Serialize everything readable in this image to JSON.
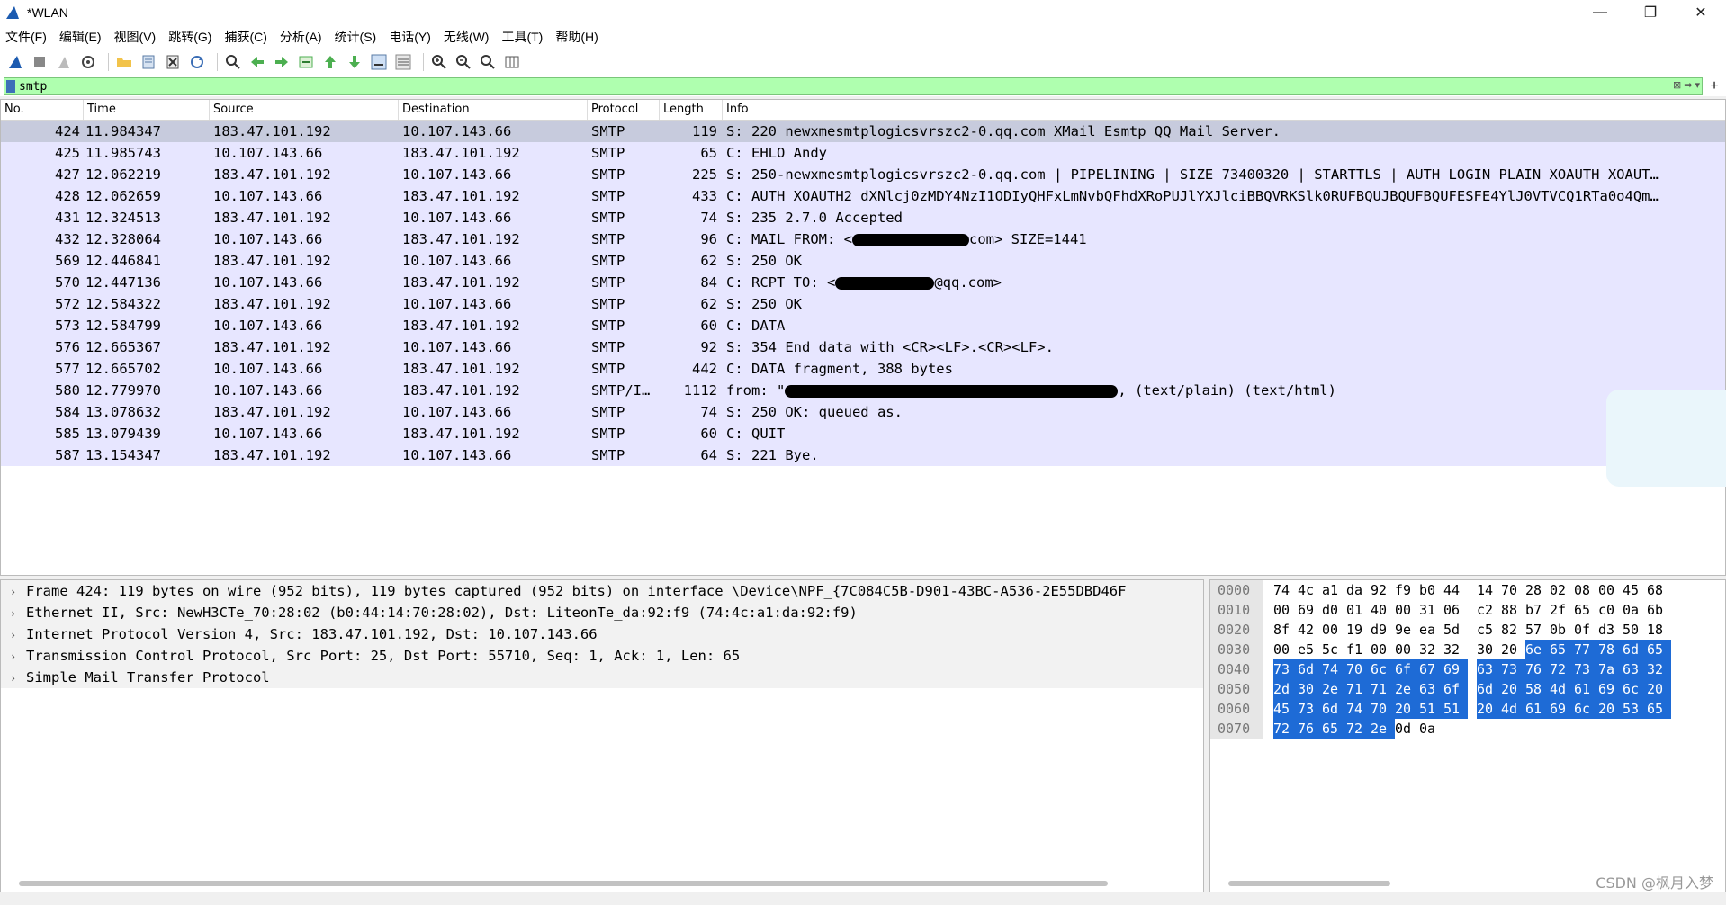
{
  "window": {
    "title": "*WLAN",
    "min": "—",
    "max": "❐",
    "close": "✕"
  },
  "menu": [
    "文件(F)",
    "编辑(E)",
    "视图(V)",
    "跳转(G)",
    "捕获(C)",
    "分析(A)",
    "统计(S)",
    "电话(Y)",
    "无线(W)",
    "工具(T)",
    "帮助(H)"
  ],
  "filter": {
    "value": "smtp",
    "plus": "+"
  },
  "columns": {
    "no": "No.",
    "time": "Time",
    "source": "Source",
    "destination": "Destination",
    "protocol": "Protocol",
    "length": "Length",
    "info": "Info"
  },
  "packets": [
    {
      "no": "424",
      "time": "11.984347",
      "src": "183.47.101.192",
      "dst": "10.107.143.66",
      "proto": "SMTP",
      "len": "119",
      "info": "S: 220 newxmesmtplogicsvrszc2-0.qq.com XMail Esmtp QQ Mail Server."
    },
    {
      "no": "425",
      "time": "11.985743",
      "src": "10.107.143.66",
      "dst": "183.47.101.192",
      "proto": "SMTP",
      "len": "65",
      "info": "C: EHLO Andy"
    },
    {
      "no": "427",
      "time": "12.062219",
      "src": "183.47.101.192",
      "dst": "10.107.143.66",
      "proto": "SMTP",
      "len": "225",
      "info": "S: 250-newxmesmtplogicsvrszc2-0.qq.com | PIPELINING | SIZE 73400320 | STARTTLS | AUTH LOGIN PLAIN XOAUTH XOAUT…"
    },
    {
      "no": "428",
      "time": "12.062659",
      "src": "10.107.143.66",
      "dst": "183.47.101.192",
      "proto": "SMTP",
      "len": "433",
      "info": "C: AUTH XOAUTH2 dXNlcj0zMDY4NzI1ODIyQHFxLmNvbQFhdXRoPUJlYXJlciBBQVRKSlk0RUFBQUJBQUFBQUFESFE4YlJ0VTVCQ1RTa0o4Qm…"
    },
    {
      "no": "431",
      "time": "12.324513",
      "src": "183.47.101.192",
      "dst": "10.107.143.66",
      "proto": "SMTP",
      "len": "74",
      "info": "S: 235 2.7.0 Accepted"
    },
    {
      "no": "432",
      "time": "12.328064",
      "src": "10.107.143.66",
      "dst": "183.47.101.192",
      "proto": "SMTP",
      "len": "96",
      "info_pre": "C: MAIL FROM: <",
      "info_post": "com> SIZE=1441",
      "redact": 130
    },
    {
      "no": "569",
      "time": "12.446841",
      "src": "183.47.101.192",
      "dst": "10.107.143.66",
      "proto": "SMTP",
      "len": "62",
      "info": "S: 250 OK"
    },
    {
      "no": "570",
      "time": "12.447136",
      "src": "10.107.143.66",
      "dst": "183.47.101.192",
      "proto": "SMTP",
      "len": "84",
      "info_pre": "C: RCPT TO: <",
      "info_post": "@qq.com>",
      "redact": 110
    },
    {
      "no": "572",
      "time": "12.584322",
      "src": "183.47.101.192",
      "dst": "10.107.143.66",
      "proto": "SMTP",
      "len": "62",
      "info": "S: 250 OK"
    },
    {
      "no": "573",
      "time": "12.584799",
      "src": "10.107.143.66",
      "dst": "183.47.101.192",
      "proto": "SMTP",
      "len": "60",
      "info": "C: DATA"
    },
    {
      "no": "576",
      "time": "12.665367",
      "src": "183.47.101.192",
      "dst": "10.107.143.66",
      "proto": "SMTP",
      "len": "92",
      "info": "S: 354 End data with <CR><LF>.<CR><LF>."
    },
    {
      "no": "577",
      "time": "12.665702",
      "src": "10.107.143.66",
      "dst": "183.47.101.192",
      "proto": "SMTP",
      "len": "442",
      "info": "C: DATA fragment, 388 bytes"
    },
    {
      "no": "580",
      "time": "12.779970",
      "src": "10.107.143.66",
      "dst": "183.47.101.192",
      "proto": "SMTP/I…",
      "len": "1112",
      "info_pre": "from: \"",
      "info_post": ",  (text/plain) (text/html)",
      "redact": 370
    },
    {
      "no": "584",
      "time": "13.078632",
      "src": "183.47.101.192",
      "dst": "10.107.143.66",
      "proto": "SMTP",
      "len": "74",
      "info": "S: 250 OK: queued as."
    },
    {
      "no": "585",
      "time": "13.079439",
      "src": "10.107.143.66",
      "dst": "183.47.101.192",
      "proto": "SMTP",
      "len": "60",
      "info": "C: QUIT"
    },
    {
      "no": "587",
      "time": "13.154347",
      "src": "183.47.101.192",
      "dst": "10.107.143.66",
      "proto": "SMTP",
      "len": "64",
      "info": "S: 221 Bye."
    }
  ],
  "details": [
    "Frame 424: 119 bytes on wire (952 bits), 119 bytes captured (952 bits) on interface \\Device\\NPF_{7C084C5B-D901-43BC-A536-2E55DBD46F",
    "Ethernet II, Src: NewH3CTe_70:28:02 (b0:44:14:70:28:02), Dst: LiteonTe_da:92:f9 (74:4c:a1:da:92:f9)",
    "Internet Protocol Version 4, Src: 183.47.101.192, Dst: 10.107.143.66",
    "Transmission Control Protocol, Src Port: 25, Dst Port: 55710, Seq: 1, Ack: 1, Len: 65",
    "Simple Mail Transfer Protocol"
  ],
  "hexdump": [
    {
      "off": "0000",
      "bytes": [
        "74",
        "4c",
        "a1",
        "da",
        "92",
        "f9",
        "b0",
        "44",
        "14",
        "70",
        "28",
        "02",
        "08",
        "00",
        "45",
        "68"
      ],
      "hl_from": 99
    },
    {
      "off": "0010",
      "bytes": [
        "00",
        "69",
        "d0",
        "01",
        "40",
        "00",
        "31",
        "06",
        "c2",
        "88",
        "b7",
        "2f",
        "65",
        "c0",
        "0a",
        "6b"
      ],
      "hl_from": 99
    },
    {
      "off": "0020",
      "bytes": [
        "8f",
        "42",
        "00",
        "19",
        "d9",
        "9e",
        "ea",
        "5d",
        "c5",
        "82",
        "57",
        "0b",
        "0f",
        "d3",
        "50",
        "18"
      ],
      "hl_from": 99
    },
    {
      "off": "0030",
      "bytes": [
        "00",
        "e5",
        "5c",
        "f1",
        "00",
        "00",
        "32",
        "32",
        "30",
        "20",
        "6e",
        "65",
        "77",
        "78",
        "6d",
        "65"
      ],
      "hl_from": 10
    },
    {
      "off": "0040",
      "bytes": [
        "73",
        "6d",
        "74",
        "70",
        "6c",
        "6f",
        "67",
        "69",
        "63",
        "73",
        "76",
        "72",
        "73",
        "7a",
        "63",
        "32"
      ],
      "hl_from": 0
    },
    {
      "off": "0050",
      "bytes": [
        "2d",
        "30",
        "2e",
        "71",
        "71",
        "2e",
        "63",
        "6f",
        "6d",
        "20",
        "58",
        "4d",
        "61",
        "69",
        "6c",
        "20"
      ],
      "hl_from": 0
    },
    {
      "off": "0060",
      "bytes": [
        "45",
        "73",
        "6d",
        "74",
        "70",
        "20",
        "51",
        "51",
        "20",
        "4d",
        "61",
        "69",
        "6c",
        "20",
        "53",
        "65"
      ],
      "hl_from": 0
    },
    {
      "off": "0070",
      "bytes": [
        "72",
        "76",
        "65",
        "72",
        "2e",
        "0d",
        "0a"
      ],
      "hl_from": 0,
      "hl_to": 5
    }
  ],
  "watermark": "CSDN @枫月入梦",
  "colors": {
    "filter_bg": "#afffaf",
    "row_bg": "#e7e6ff",
    "selected_row": "#c7cbdd",
    "hex_highlight": "#1e6bd6"
  }
}
